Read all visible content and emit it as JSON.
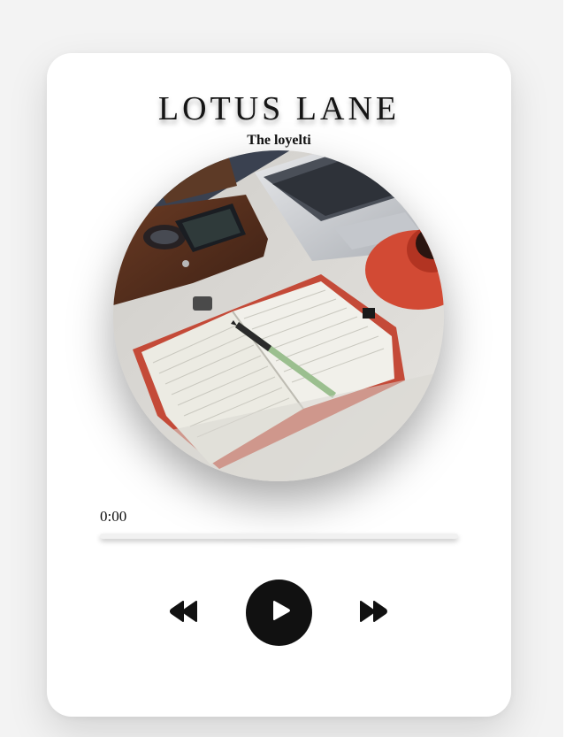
{
  "player": {
    "title": "LOTUS LANE",
    "artist": "The loyelti",
    "current_time": "0:00",
    "progress": 0
  },
  "controls": {
    "previous_icon": "rewind-icon",
    "play_icon": "play-icon",
    "next_icon": "fast-forward-icon"
  },
  "colors": {
    "background": "#f3f3f3",
    "card": "#ffffff",
    "play_button": "#111111",
    "icon": "#111111"
  }
}
